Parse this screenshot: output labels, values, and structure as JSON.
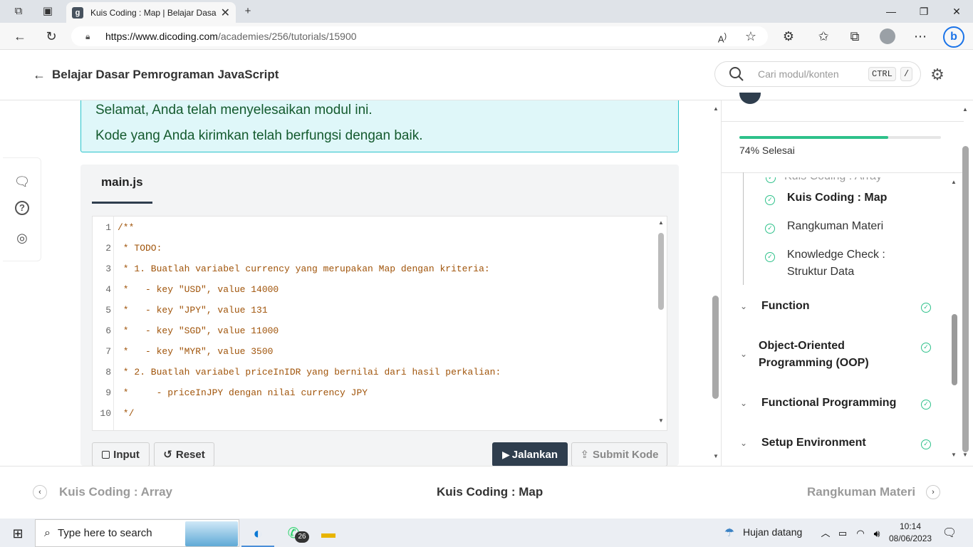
{
  "browser": {
    "tab_title": "Kuis Coding : Map | Belajar Dasar Pemrograman JavaScript",
    "favicon_letter": "g",
    "url_host": "https://www.dicoding.com",
    "url_path": "/academies/256/tutorials/15900"
  },
  "header": {
    "back_title": "Belajar Dasar Pemrograman JavaScript",
    "search_placeholder": "Cari modul/konten",
    "shortcut_key1": "CTRL",
    "shortcut_key2": "/"
  },
  "success": {
    "line1": "Selamat, Anda telah menyelesaikan modul ini.",
    "line2": "Kode yang Anda kirimkan telah berfungsi dengan baik."
  },
  "editor": {
    "file_tab": "main.js",
    "lines": [
      {
        "n": "1",
        "text": "/**"
      },
      {
        "n": "2",
        "text": " * TODO:"
      },
      {
        "n": "3",
        "text": " * 1. Buatlah variabel currency yang merupakan Map dengan kriteria:"
      },
      {
        "n": "4",
        "text": " *   - key \"USD\", value 14000"
      },
      {
        "n": "5",
        "text": " *   - key \"JPY\", value 131"
      },
      {
        "n": "6",
        "text": " *   - key \"SGD\", value 11000"
      },
      {
        "n": "7",
        "text": " *   - key \"MYR\", value 3500"
      },
      {
        "n": "8",
        "text": " * 2. Buatlah variabel priceInIDR yang bernilai dari hasil perkalian:"
      },
      {
        "n": "9",
        "text": " *     - priceInJPY dengan nilai currency JPY"
      },
      {
        "n": "10",
        "text": " */"
      }
    ],
    "btn_input": "Input",
    "btn_reset": "Reset",
    "btn_run": "Jalankan",
    "btn_submit": "Submit Kode"
  },
  "sidebar": {
    "progress_percent": 74,
    "progress_text": "74% Selesai",
    "cutoff_item": "Kuis Coding : Array",
    "sub_items": [
      {
        "label": "Kuis Coding : Map",
        "active": true
      },
      {
        "label": "Rangkuman Materi",
        "active": false
      },
      {
        "label": "Knowledge Check : Struktur Data",
        "active": false
      }
    ],
    "modules": [
      {
        "label": "Function"
      },
      {
        "label": "Object-Oriented Programming (OOP)"
      },
      {
        "label": "Functional Programming"
      },
      {
        "label": "Setup Environment"
      }
    ]
  },
  "bottom_nav": {
    "prev": "Kuis Coding : Array",
    "current": "Kuis Coding : Map",
    "next": "Rangkuman Materi"
  },
  "taskbar": {
    "search_placeholder": "Type here to search",
    "whatsapp_badge": "26",
    "weather": "Hujan datang",
    "time": "10:14",
    "date": "08/06/2023"
  },
  "colors": {
    "success_bg": "#dff7f9",
    "success_border": "#29c4cc",
    "success_text": "#145a2e",
    "accent_dark": "#2f3e4e",
    "check_green": "#2ec18a",
    "code_comment": "#a0540a"
  }
}
